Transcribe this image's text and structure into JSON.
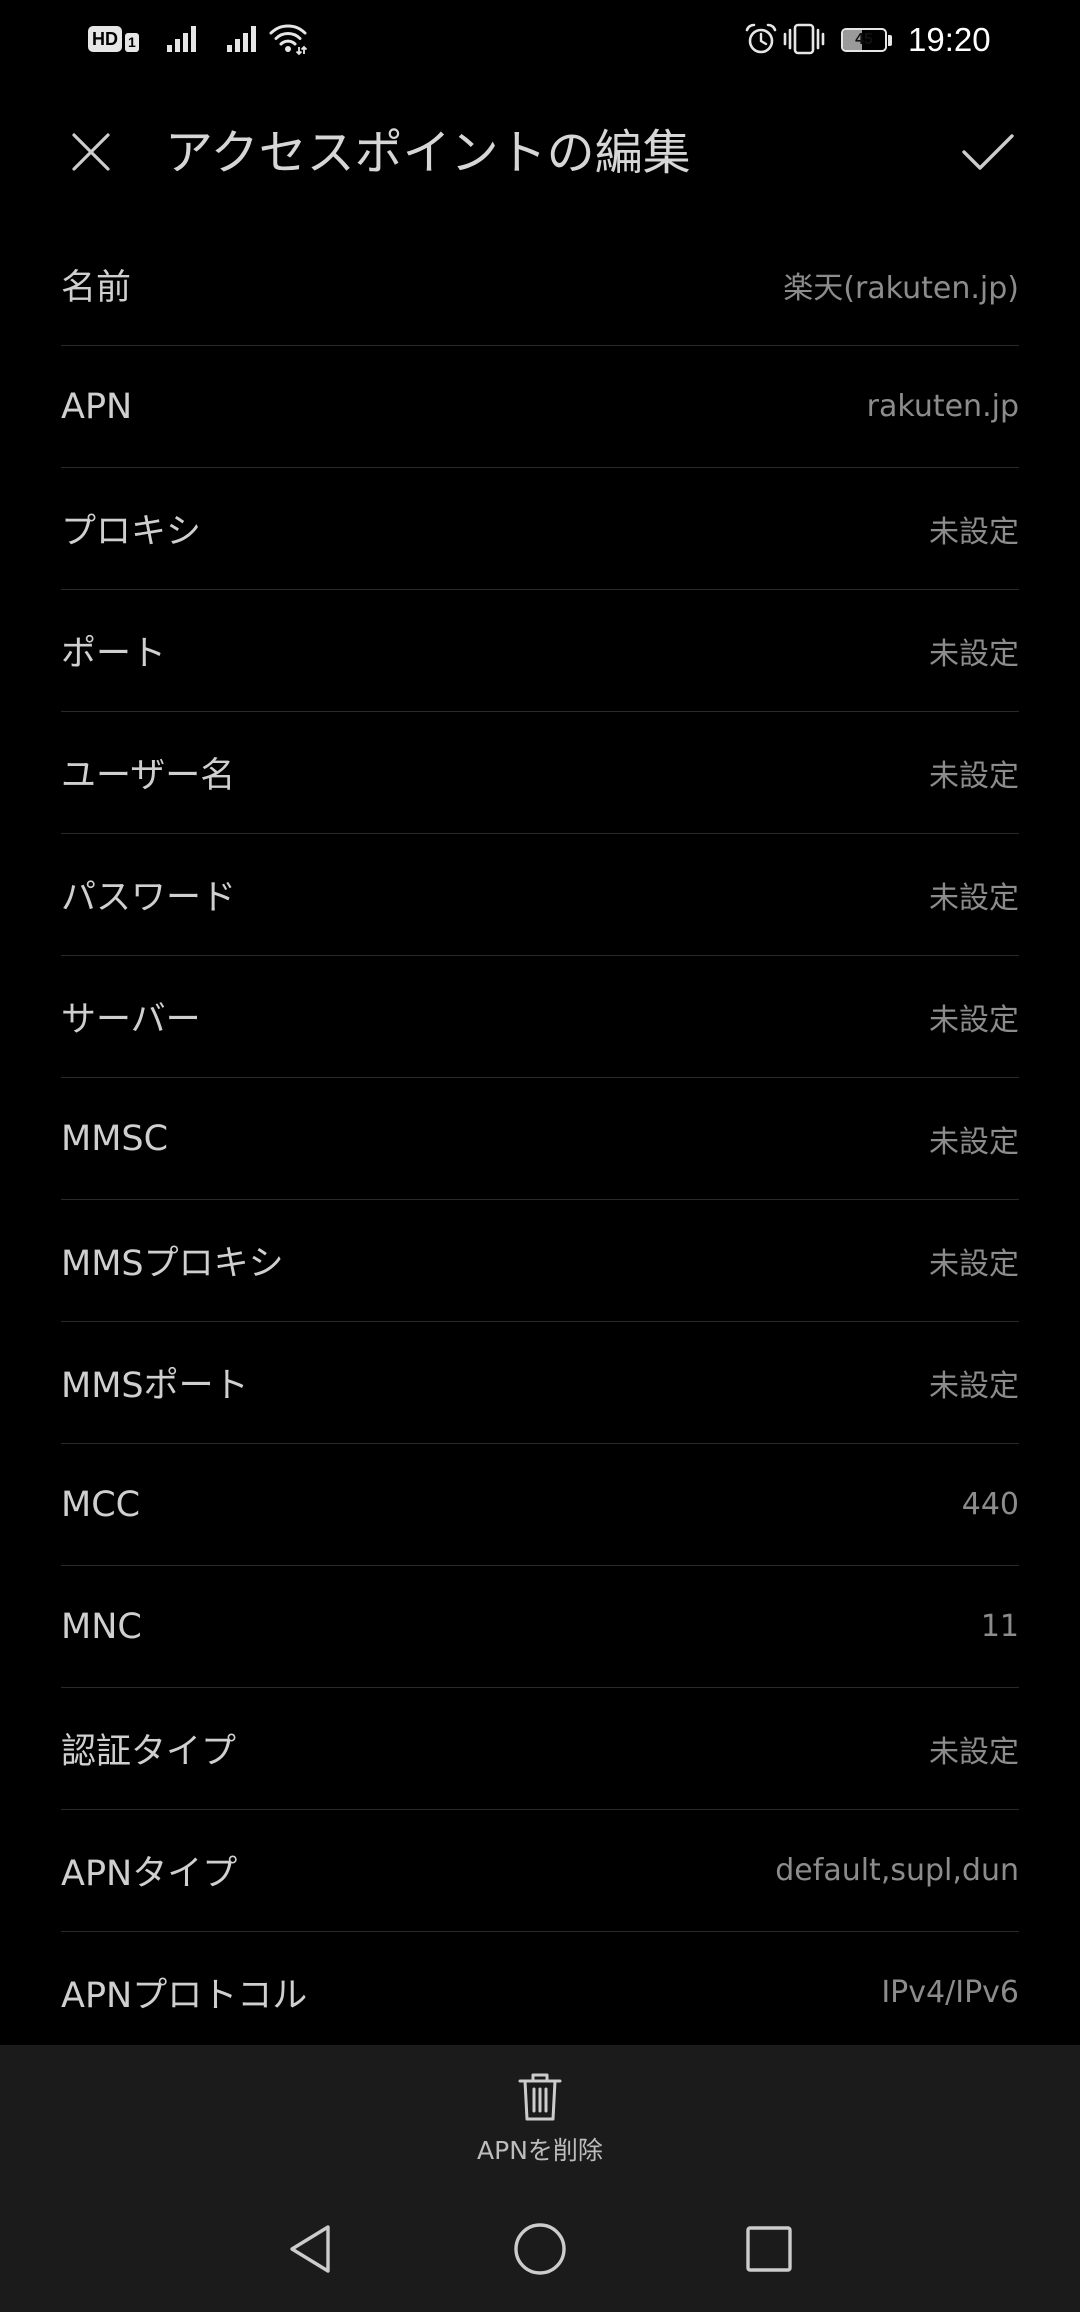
{
  "status_bar": {
    "hd_badge": {
      "label": "HD",
      "sim": "1",
      "icon": "hd-voice-icon"
    },
    "signal_icons": [
      "signal-icon",
      "signal-icon"
    ],
    "wifi_icon": "wifi-icon",
    "alarm_icon": "alarm-icon",
    "vibrate_icon": "vibrate-icon",
    "battery": {
      "level": 45,
      "label": "45",
      "icon": "battery-icon"
    },
    "time": "19:20"
  },
  "header": {
    "close_icon": "close-icon",
    "title": "アクセスポイントの編集",
    "confirm_icon": "check-icon"
  },
  "fields": [
    {
      "label": "名前",
      "value": "楽天(rakuten.jp)"
    },
    {
      "label": "APN",
      "value": "rakuten.jp"
    },
    {
      "label": "プロキシ",
      "value": "未設定"
    },
    {
      "label": "ポート",
      "value": "未設定"
    },
    {
      "label": "ユーザー名",
      "value": "未設定"
    },
    {
      "label": "パスワード",
      "value": "未設定"
    },
    {
      "label": "サーバー",
      "value": "未設定"
    },
    {
      "label": "MMSC",
      "value": "未設定"
    },
    {
      "label": "MMSプロキシ",
      "value": "未設定"
    },
    {
      "label": "MMSポート",
      "value": "未設定"
    },
    {
      "label": "MCC",
      "value": "440"
    },
    {
      "label": "MNC",
      "value": "11"
    },
    {
      "label": "認証タイプ",
      "value": "未設定"
    },
    {
      "label": "APNタイプ",
      "value": "default,supl,dun"
    },
    {
      "label": "APNプロトコル",
      "value": "IPv4/IPv6"
    }
  ],
  "footer": {
    "delete_icon": "trash-icon",
    "delete_label": "APNを削除"
  },
  "nav_bar": {
    "back_icon": "back-triangle-icon",
    "home_icon": "home-circle-icon",
    "recents_icon": "recents-square-icon"
  },
  "colors": {
    "background": "#000000",
    "label": "#cfcfcf",
    "value": "#8c8c8c",
    "divider": "#2a2a2a",
    "panel": "#1b1b1b",
    "icon": "#cccccc"
  }
}
